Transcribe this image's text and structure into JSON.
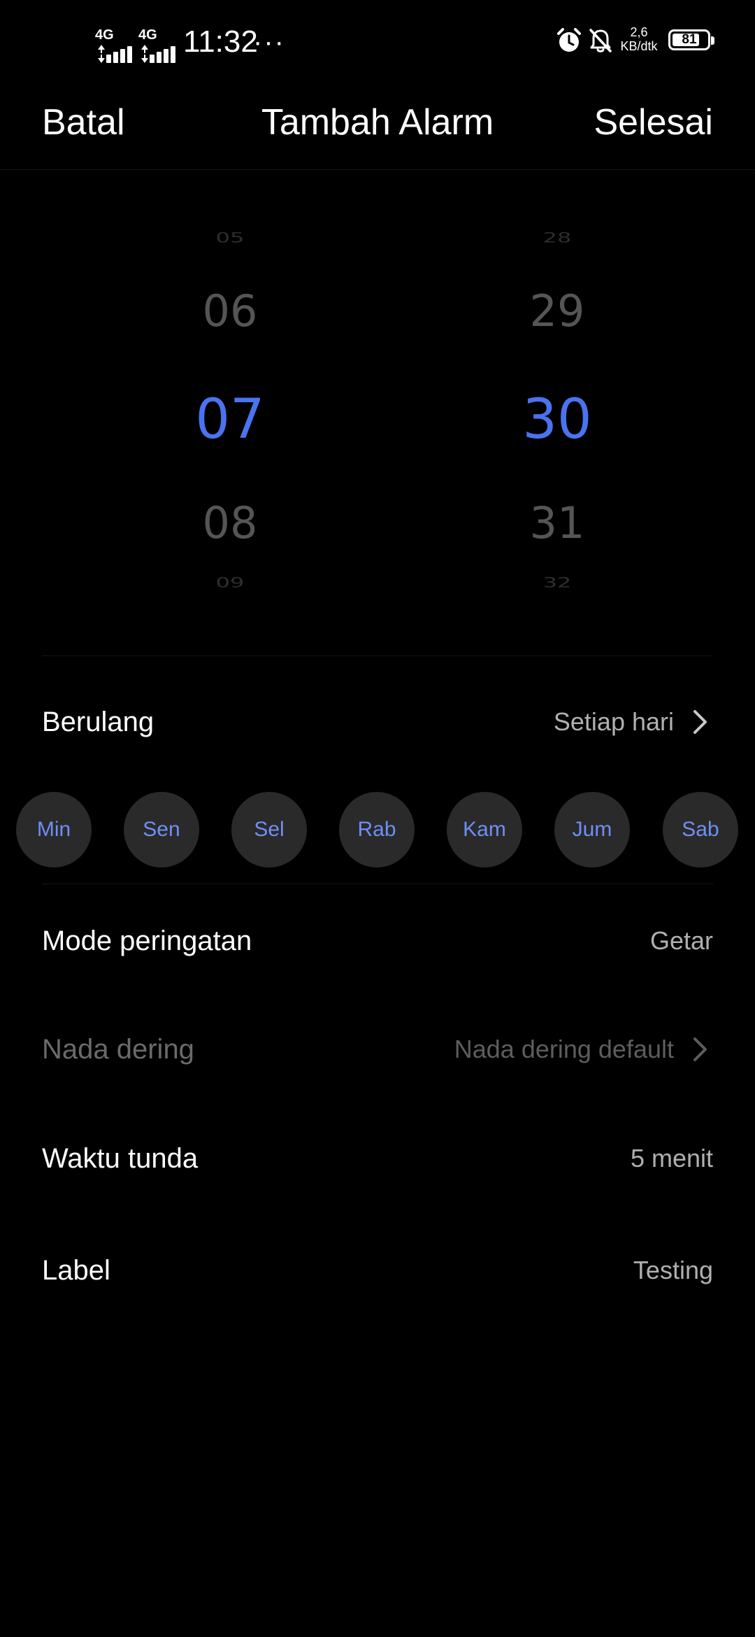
{
  "status_bar": {
    "net1": "4G",
    "net2": "4G",
    "time": "11:32",
    "more": "···",
    "net_speed_value": "2,6",
    "net_speed_unit": "KB/dtk",
    "battery": "81",
    "battery_level": 0.81,
    "icons": [
      "alarm-icon",
      "silent-bell-icon"
    ]
  },
  "header": {
    "cancel": "Batal",
    "title": "Tambah Alarm",
    "done": "Selesai"
  },
  "picker": {
    "hour": {
      "far_top": "05",
      "near_top": "06",
      "selected": "07",
      "near_bottom": "08",
      "far_bottom": "09"
    },
    "minute": {
      "far_top": "28",
      "near_top": "29",
      "selected": "30",
      "near_bottom": "31",
      "far_bottom": "32"
    },
    "selected_color": "#4a73f0"
  },
  "repeat": {
    "label": "Berulang",
    "value": "Setiap hari"
  },
  "days": [
    "Min",
    "Sen",
    "Sel",
    "Rab",
    "Kam",
    "Jum",
    "Sab"
  ],
  "alert_mode": {
    "label": "Mode peringatan",
    "value": "Getar"
  },
  "ringtone": {
    "label": "Nada dering",
    "value": "Nada dering default"
  },
  "snooze": {
    "label": "Waktu tunda",
    "value": "5 menit"
  },
  "alarm_label": {
    "label": "Label",
    "value": "Testing"
  }
}
